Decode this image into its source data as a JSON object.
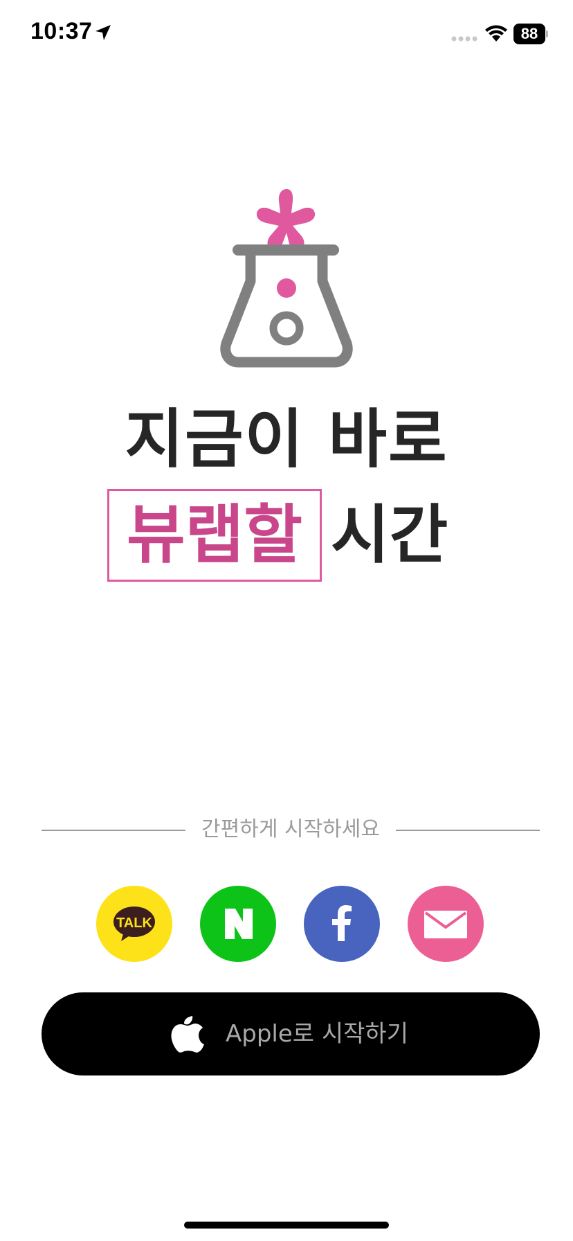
{
  "status_bar": {
    "time": "10:37",
    "battery": "88"
  },
  "headline": {
    "line1": "지금이 바로",
    "highlight": "뷰랩할",
    "suffix": "시간"
  },
  "divider": {
    "text": "간편하게 시작하세요"
  },
  "social": {
    "kakao_label": "TALK",
    "naver_label": "N"
  },
  "apple_button": {
    "label": "Apple로 시작하기"
  },
  "icons": {
    "location": "location-arrow-icon",
    "wifi": "wifi-icon",
    "logo": "beaker-flask-logo",
    "kakao": "kakao-talk-icon",
    "naver": "naver-icon",
    "facebook": "facebook-icon",
    "email": "envelope-icon",
    "apple": "apple-icon"
  },
  "colors": {
    "brand_pink": "#e0589e",
    "highlight_text": "#c9468a",
    "kakao_yellow": "#fde21a",
    "naver_green": "#0ec318",
    "facebook_blue": "#4864bf",
    "email_pink": "#ec5f95",
    "flask_gray": "#808080"
  }
}
